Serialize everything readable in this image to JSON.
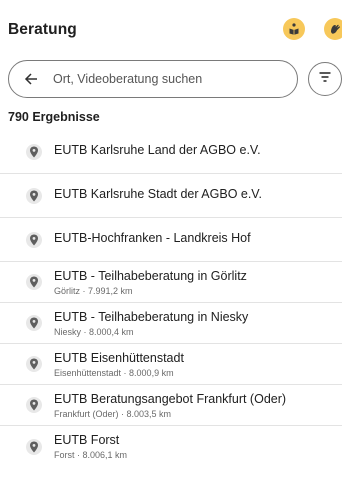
{
  "header": {
    "title": "Beratung",
    "easy_language_icon": "easy-language-icon",
    "sign_language_icon": "sign-language-icon"
  },
  "search": {
    "placeholder": "Ort, Videoberatung suchen",
    "back_icon": "arrow-left-icon",
    "filter_icon": "filter-icon"
  },
  "results": {
    "count": "790 Ergebnisse",
    "items": [
      {
        "name": "EUTB Karlsruhe Land der AGBO e.V.",
        "detail": ""
      },
      {
        "name": "EUTB Karlsruhe Stadt der AGBO e.V.",
        "detail": ""
      },
      {
        "name": "EUTB-Hochfranken - Landkreis Hof",
        "detail": ""
      },
      {
        "name": "EUTB - Teilhabeberatung in Görlitz",
        "detail": "Görlitz · 7.991,2 km"
      },
      {
        "name": "EUTB - Teilhabeberatung in Niesky",
        "detail": "Niesky · 8.000,4 km"
      },
      {
        "name": "EUTB Eisenhüttenstadt",
        "detail": "Eisenhüttenstadt · 8.000,9 km"
      },
      {
        "name": "EUTB Beratungsangebot Frankfurt (Oder)",
        "detail": "Frankfurt (Oder) · 8.003,5 km"
      },
      {
        "name": "EUTB Forst",
        "detail": "Forst · 8.006,1 km"
      }
    ]
  },
  "colors": {
    "accent": "#f7c85a",
    "pin_bg": "#e8e8e8",
    "pin_icon": "#5f5f5f"
  }
}
